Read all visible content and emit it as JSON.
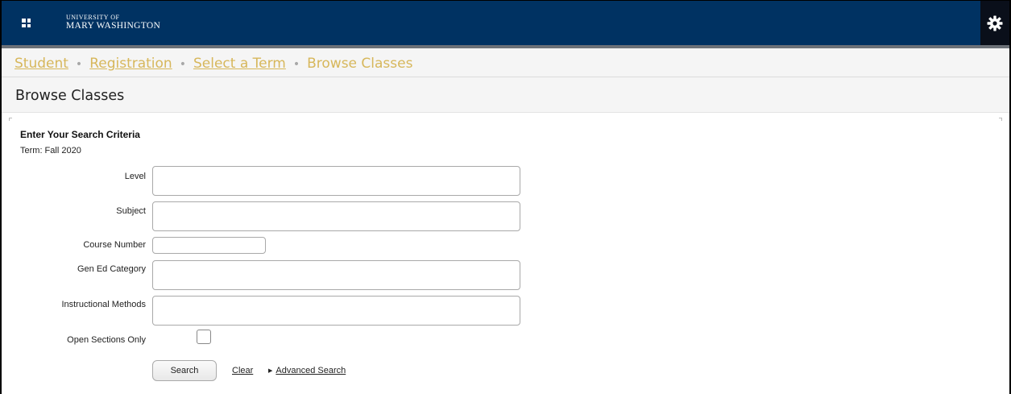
{
  "header": {
    "logo_line1": "UNIVERSITY OF",
    "logo_line2": "MARY WASHINGTON",
    "bar_color": "#003262"
  },
  "breadcrumbs": {
    "items": [
      "Student",
      "Registration",
      "Select a Term"
    ],
    "current": "Browse Classes",
    "separator": "•"
  },
  "page": {
    "title": "Browse Classes"
  },
  "search": {
    "heading": "Enter Your Search Criteria",
    "term": "Term: Fall 2020",
    "fields": {
      "level": {
        "label": "Level",
        "value": ""
      },
      "subject": {
        "label": "Subject",
        "value": ""
      },
      "course_number": {
        "label": "Course Number",
        "value": ""
      },
      "gen_ed": {
        "label": "Gen Ed Category",
        "value": ""
      },
      "methods": {
        "label": "Instructional Methods",
        "value": ""
      }
    },
    "open_sections": {
      "label": "Open Sections Only",
      "checked": false
    },
    "search_label": "Search",
    "clear_label": "Clear",
    "advanced_label": "Advanced Search"
  },
  "icons": {
    "apps": "grid-icon",
    "settings": "gear-icon",
    "advanced": "triangle-right-icon"
  }
}
